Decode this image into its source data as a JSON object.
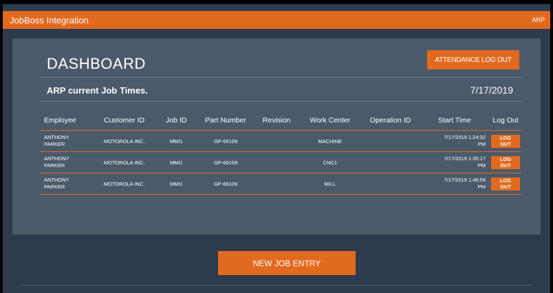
{
  "app": {
    "title": "JobBoss Integration",
    "user": "ARP"
  },
  "dashboard": {
    "title": "DASHBOARD",
    "attendance_logout_label": "ATTENDANCE LOG OUT",
    "subtitle": "ARP current Job Times.",
    "date": "7/17/2019"
  },
  "table": {
    "headers": [
      "Employee",
      "Customer ID",
      "Job ID",
      "Part Number",
      "Revision",
      "Work Center",
      "Operation ID",
      "Start Time",
      "Log Out"
    ],
    "rows": [
      {
        "employee_first": "ANTHONY",
        "employee_last": "PARKER",
        "customer_id": "MOTOROLA INC.",
        "job_id": "MMI1",
        "part_number": "GP-66109",
        "revision": "",
        "work_center": "MACHINE",
        "operation_id": "",
        "start_time_1": "7/17/2019 1:24:32",
        "start_time_2": "PM",
        "logout_label": "LOG OUT"
      },
      {
        "employee_first": "ANTHONY",
        "employee_last": "PARKER",
        "customer_id": "MOTOROLA INC.",
        "job_id": "MMI1",
        "part_number": "GP-66109",
        "revision": "",
        "work_center": "CNC1",
        "operation_id": "",
        "start_time_1": "7/17/2019 1:35:17",
        "start_time_2": "PM",
        "logout_label": "LOG OUT"
      },
      {
        "employee_first": "ANTHONY",
        "employee_last": "PARKER",
        "customer_id": "MOTOROLA INC.",
        "job_id": "MMI1",
        "part_number": "GP-66109",
        "revision": "",
        "work_center": "MILL",
        "operation_id": "",
        "start_time_1": "7/17/2019 1:46:59",
        "start_time_2": "PM",
        "logout_label": "LOG OUT"
      }
    ]
  },
  "footer": {
    "new_job_label": "NEW JOB ENTRY"
  },
  "colors": {
    "accent": "#e26a1f",
    "background": "#2c3b4d",
    "panel": "#4b5a6a"
  }
}
